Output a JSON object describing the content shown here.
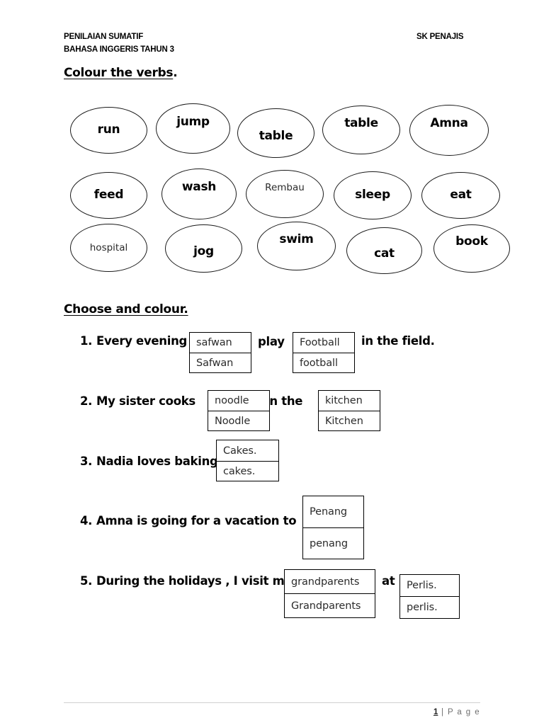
{
  "header": {
    "line1": "PENILAIAN SUMATIF",
    "line2": "BAHASA INGGERIS TAHUN 3",
    "school": "SK PENAJIS"
  },
  "section1": {
    "instruction_prefix": "Colour the ",
    "instruction_keyword": "verbs",
    "instruction_suffix": ".",
    "ovals": [
      {
        "label": "run"
      },
      {
        "label": "jump"
      },
      {
        "label": "table"
      },
      {
        "label": "table"
      },
      {
        "label": "Amna"
      },
      {
        "label": "feed"
      },
      {
        "label": "wash"
      },
      {
        "label": "Rembau"
      },
      {
        "label": "sleep"
      },
      {
        "label": "eat"
      },
      {
        "label": "hospital"
      },
      {
        "label": "jog"
      },
      {
        "label": "swim"
      },
      {
        "label": "cat"
      },
      {
        "label": "book"
      }
    ]
  },
  "section2": {
    "instruction": "Choose and colour.",
    "questions": [
      {
        "number": "1.",
        "text_before": "Every evening",
        "text_middle": "play",
        "text_after": "in the field.",
        "box1": {
          "top": "safwan",
          "bottom": "Safwan"
        },
        "box2": {
          "top": "Football",
          "bottom": "football"
        }
      },
      {
        "number": "2.",
        "text_before": "My sister cooks",
        "text_middle": "in the",
        "text_after": "",
        "box1": {
          "top": "noodle",
          "bottom": "Noodle"
        },
        "box2": {
          "top": "kitchen",
          "bottom": "Kitchen"
        }
      },
      {
        "number": "3.",
        "text_before": "Nadia loves baking",
        "text_middle": "",
        "text_after": "",
        "box1": {
          "top": "Cakes.",
          "bottom": "cakes."
        }
      },
      {
        "number": "4.",
        "text_before": "Amna is going for a vacation to",
        "text_middle": "",
        "text_after": "",
        "box1": {
          "top": "Penang",
          "bottom": "penang"
        }
      },
      {
        "number": "5.",
        "text_before": "During the holidays , I visit my",
        "text_middle": "at",
        "text_after": "",
        "box1": {
          "top": "grandparents",
          "bottom": "Grandparents"
        },
        "box2": {
          "top": "Perlis.",
          "bottom": "perlis."
        }
      }
    ]
  },
  "footer": {
    "page_number": "1",
    "separator": " | ",
    "page_word": "P a g e"
  }
}
